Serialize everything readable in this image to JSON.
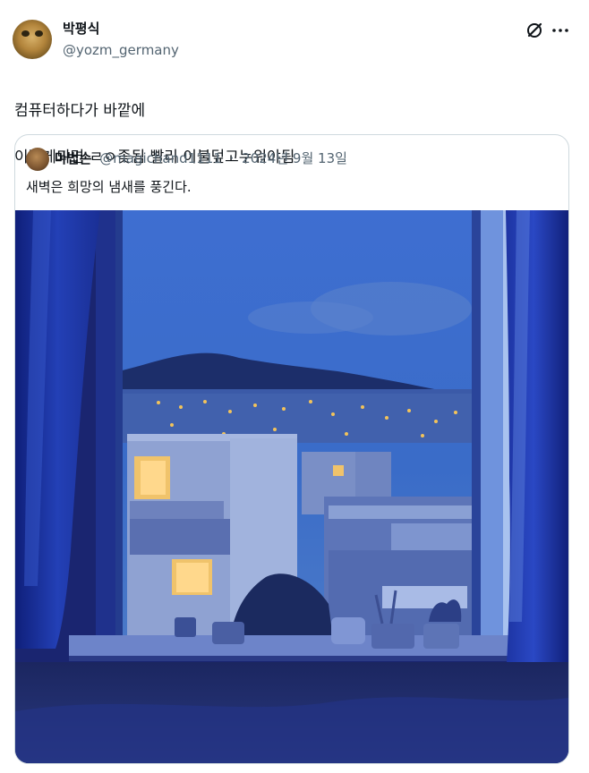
{
  "tweet": {
    "author_name": "박평식",
    "author_handle": "@yozm_germany",
    "text_line1": "컴퓨터하다가 바깥에",
    "text_line2": "이렇게되면 ㄹㅇ좆됨 빨리 이불덮고누워야됨"
  },
  "quoted": {
    "author_name": "마법손",
    "author_handle": "@magichand1111",
    "date": "2024년 9월 13일",
    "separator": "·",
    "text": "새벽은 희망의 냄새를 풍긴다."
  },
  "icons": {
    "grok": "slash-circle-icon",
    "more": "more-icon"
  }
}
